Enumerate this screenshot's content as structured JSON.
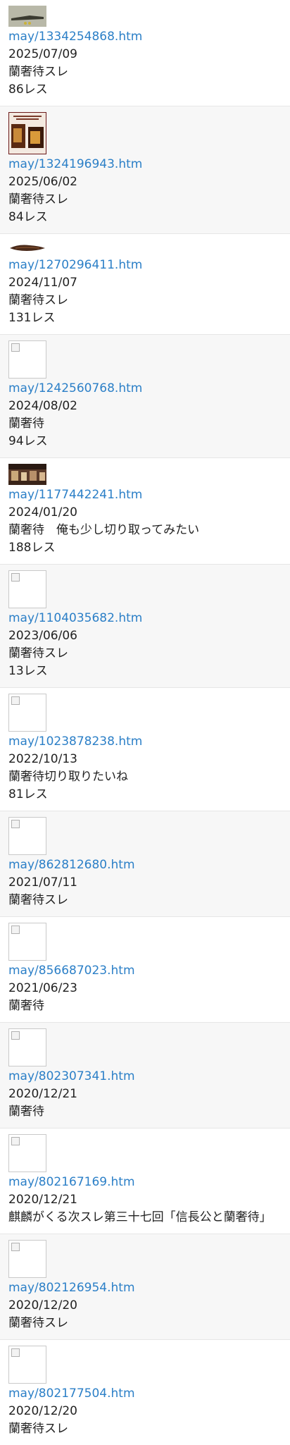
{
  "threads": [
    {
      "link": "may/1334254868.htm",
      "date": "2025/07/09",
      "title": "蘭奢待スレ",
      "replies": "86レス",
      "thumbnail": "sword-photo"
    },
    {
      "link": "may/1324196943.htm",
      "date": "2025/06/02",
      "title": "蘭奢待スレ",
      "replies": "84レス",
      "thumbnail": "poster-photo"
    },
    {
      "link": "may/1270296411.htm",
      "date": "2024/11/07",
      "title": "蘭奢待スレ",
      "replies": "131レス",
      "thumbnail": "wood-piece-photo"
    },
    {
      "link": "may/1242560768.htm",
      "date": "2024/08/02",
      "title": "蘭奢待",
      "replies": "94レス",
      "thumbnail": "broken-image"
    },
    {
      "link": "may/1177442241.htm",
      "date": "2024/01/20",
      "title": "蘭奢待　俺も少し切り取ってみたい",
      "replies": "188レス",
      "thumbnail": "exhibit-photo"
    },
    {
      "link": "may/1104035682.htm",
      "date": "2023/06/06",
      "title": "蘭奢待スレ",
      "replies": "13レス",
      "thumbnail": "broken-image"
    },
    {
      "link": "may/1023878238.htm",
      "date": "2022/10/13",
      "title": "蘭奢待切り取りたいね",
      "replies": "81レス",
      "thumbnail": "broken-image"
    },
    {
      "link": "may/862812680.htm",
      "date": "2021/07/11",
      "title": "蘭奢待スレ",
      "replies": "",
      "thumbnail": "broken-image"
    },
    {
      "link": "may/856687023.htm",
      "date": "2021/06/23",
      "title": "蘭奢待",
      "replies": "",
      "thumbnail": "broken-image"
    },
    {
      "link": "may/802307341.htm",
      "date": "2020/12/21",
      "title": "蘭奢待",
      "replies": "",
      "thumbnail": "broken-image"
    },
    {
      "link": "may/802167169.htm",
      "date": "2020/12/21",
      "title": "麒麟がくる次スレ第三十七回「信長公と蘭奢待」",
      "replies": "",
      "thumbnail": "broken-image"
    },
    {
      "link": "may/802126954.htm",
      "date": "2020/12/20",
      "title": "蘭奢待スレ",
      "replies": "",
      "thumbnail": "broken-image"
    },
    {
      "link": "may/802177504.htm",
      "date": "2020/12/20",
      "title": "蘭奢待スレ",
      "replies": "",
      "thumbnail": "broken-image"
    }
  ]
}
